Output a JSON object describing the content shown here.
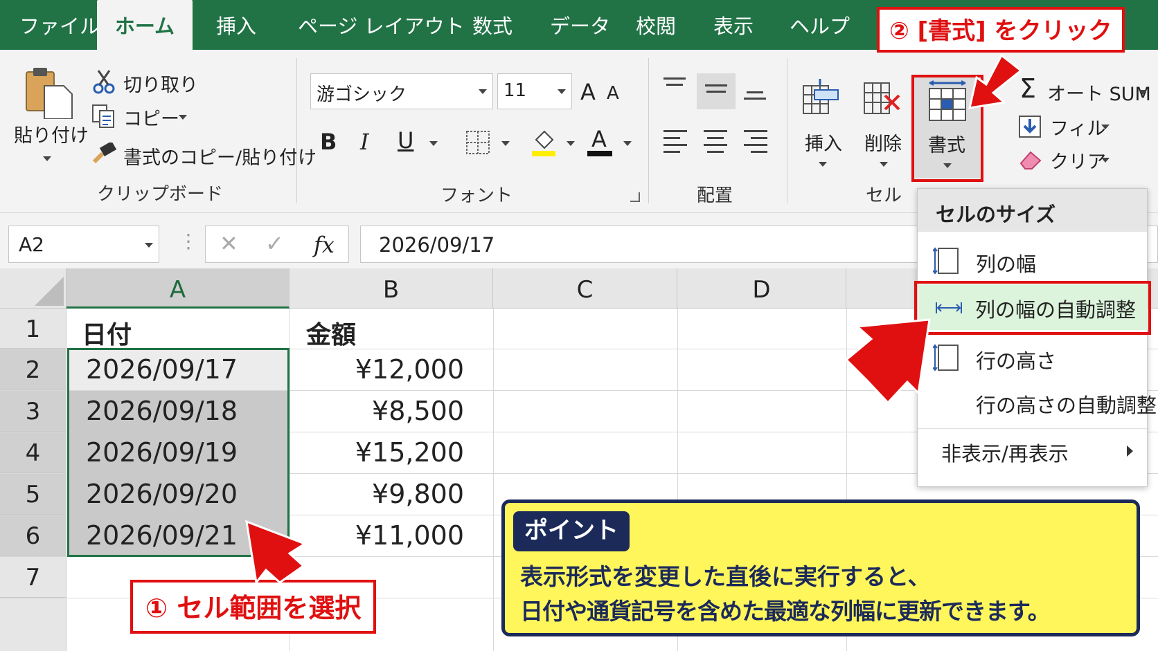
{
  "tabs": [
    "ファイル",
    "ホーム",
    "挿入",
    "ページ レイアウト",
    "数式",
    "データ",
    "校閲",
    "表示",
    "ヘルプ"
  ],
  "clipboard": {
    "paste": "貼り付け",
    "cut": "切り取り",
    "copy": "コピー",
    "format_painter": "書式のコピー/貼り付け",
    "group": "クリップボード"
  },
  "font": {
    "name": "游ゴシック",
    "size": "11",
    "bold": "B",
    "italic": "I",
    "underline": "U",
    "font_color_letter": "A",
    "grow": "A",
    "shrink": "A",
    "group": "フォント"
  },
  "alignment": {
    "group": "配置"
  },
  "cells_group": {
    "insert": "挿入",
    "delete": "削除",
    "format": "書式",
    "group": "セル"
  },
  "editing": {
    "autosum": "オート SUM",
    "fill": "フィル",
    "clear": "クリア"
  },
  "formula_bar": {
    "name_box": "A2",
    "fx": "fx",
    "value": "2026/09/17"
  },
  "columns": [
    "A",
    "B",
    "C",
    "D"
  ],
  "rows": [
    "1",
    "2",
    "3",
    "4",
    "5",
    "6",
    "7"
  ],
  "table": {
    "headers": [
      "日付",
      "金額"
    ],
    "dates": [
      "2026/09/17",
      "2026/09/18",
      "2026/09/19",
      "2026/09/20",
      "2026/09/21"
    ],
    "amounts": [
      "¥12,000",
      "¥8,500",
      "¥15,200",
      "¥9,800",
      "¥11,000"
    ]
  },
  "menu": {
    "title": "セルのサイズ",
    "items": [
      "列の幅",
      "列の幅の自動調整",
      "行の高さ",
      "行の高さの自動調整",
      "非表示/再表示"
    ]
  },
  "callouts": {
    "step1": "① セル範囲を選択",
    "step2": "② [書式] をクリック"
  },
  "point": {
    "badge": "ポイント",
    "line1": "表示形式を変更した直後に実行すると、",
    "line2": "日付や通貨記号を含めた最適な列幅に更新できます。"
  },
  "colors": {
    "excel_green": "#217346",
    "highlight_red": "#e01010",
    "point_bg": "#fef65b",
    "point_border": "#1c2a5a",
    "selected_range": "#c9c9c9"
  }
}
